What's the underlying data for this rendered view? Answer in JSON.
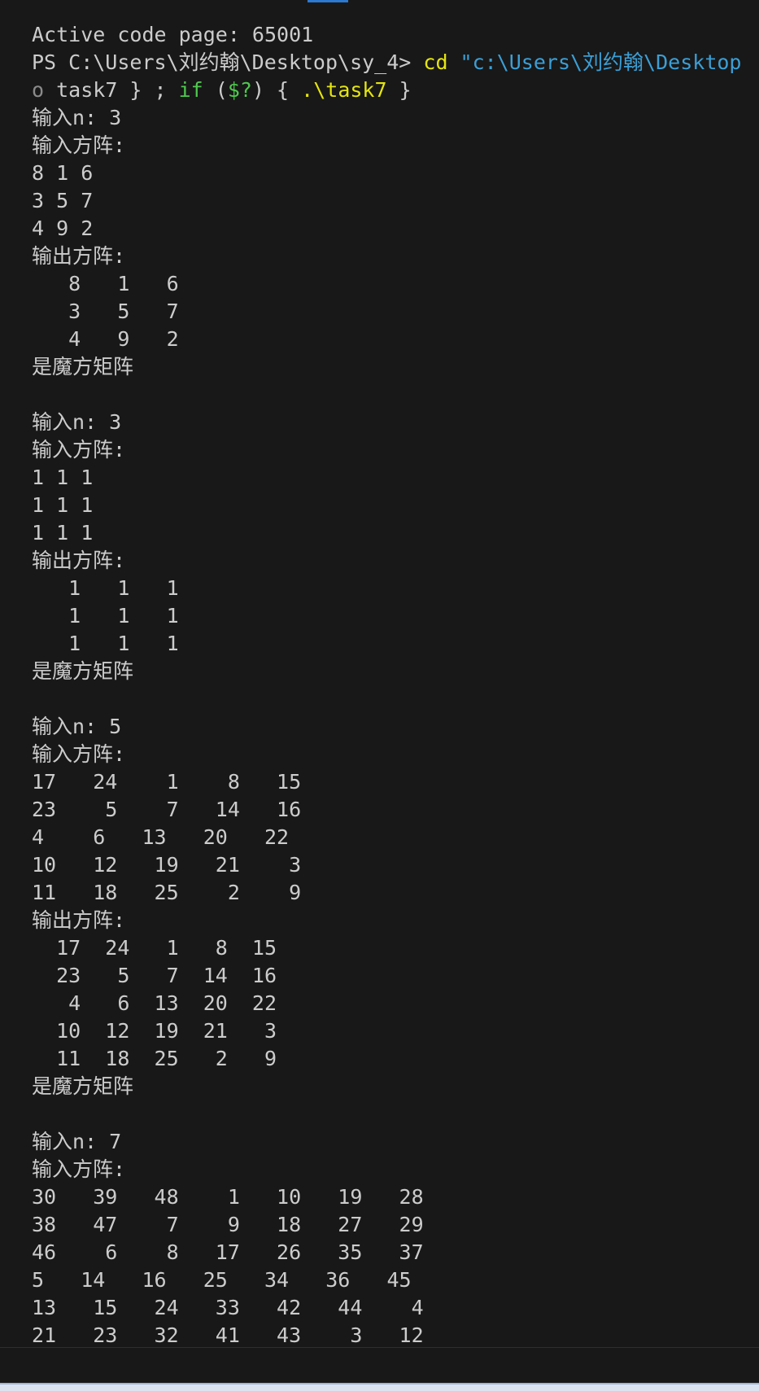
{
  "terminal": {
    "header": {
      "code_page": "Active code page: 65001",
      "prompt": "PS C:\\Users\\刘约翰\\Desktop\\sy_4> ",
      "command": "cd ",
      "command_path": "\"c:\\Users\\刘约翰\\Desktop",
      "cont_prefix": "o ",
      "cont_task": "task7 } ; ",
      "cont_if": "if ",
      "cont_paren_open": "(",
      "cont_var": "$?",
      "cont_paren_close": ") { ",
      "cont_exe": ".\\task7",
      "cont_end": " }"
    },
    "runs": [
      {
        "input_n": "输入n: 3",
        "input_label": "输入方阵:",
        "input_rows": [
          "8 1 6",
          "3 5 7",
          "4 9 2"
        ],
        "output_label": "输出方阵:",
        "output_rows": [
          "   8   1   6",
          "   3   5   7",
          "   4   9   2"
        ],
        "result": "是魔方矩阵"
      },
      {
        "input_n": "输入n: 3",
        "input_label": "输入方阵:",
        "input_rows": [
          "1 1 1",
          "1 1 1",
          "1 1 1"
        ],
        "output_label": "输出方阵:",
        "output_rows": [
          "   1   1   1",
          "   1   1   1",
          "   1   1   1"
        ],
        "result": "是魔方矩阵"
      },
      {
        "input_n": "输入n: 5",
        "input_label": "输入方阵:",
        "input_rows": [
          "17   24    1    8   15",
          "23    5    7   14   16",
          "4    6   13   20   22",
          "10   12   19   21    3",
          "11   18   25    2    9"
        ],
        "output_label": "输出方阵:",
        "output_rows": [
          "  17  24   1   8  15",
          "  23   5   7  14  16",
          "   4   6  13  20  22",
          "  10  12  19  21   3",
          "  11  18  25   2   9"
        ],
        "result": "是魔方矩阵"
      }
    ],
    "last_run": {
      "input_n": "输入n: 7",
      "input_label": "输入方阵:",
      "input_rows": [
        "30   39   48    1   10   19   28",
        "38   47    7    9   18   27   29",
        "46    6    8   17   26   35   37",
        "5   14   16   25   34   36   45",
        "13   15   24   33   42   44    4",
        "21   23   32   41   43    3   12"
      ]
    }
  }
}
